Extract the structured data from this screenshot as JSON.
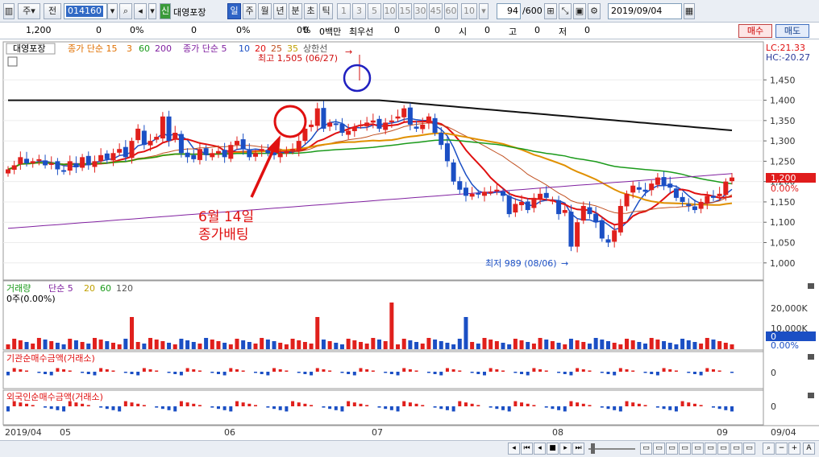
{
  "toolbar": {
    "period": "주",
    "prefix": "전",
    "code": "014160",
    "badge": "신",
    "name": "대영포장",
    "periods": [
      "일",
      "주",
      "월",
      "년",
      "분",
      "초",
      "틱"
    ],
    "nums": [
      "1",
      "3",
      "5",
      "10",
      "15",
      "30",
      "45",
      "60",
      "10"
    ],
    "count": "94",
    "total": "/600",
    "date": "2019/09/04"
  },
  "info": {
    "price": "1,200",
    "change": "0",
    "rate": "0%",
    "v1": "0",
    "pct1": "0%",
    "v2": "0",
    "pct2": "0%",
    "vol": "0백만",
    "hoga": "최우선",
    "h1": "0",
    "h2": "0",
    "s_label": "시",
    "s_val": "0",
    "g_label": "고",
    "g_val": "0",
    "j_label": "저",
    "j_val": "0",
    "buy": "매수",
    "sell": "매도"
  },
  "legend": {
    "name": "대영포장",
    "ma_a": "종가 단순 15",
    "a2": "3",
    "a3": "60",
    "a4": "200",
    "ma_b": "종가 단순 5",
    "b2": "10",
    "b3": "20",
    "b4": "25",
    "b5": "35",
    "b6": "상한선"
  },
  "scale": {
    "lc": "LC:21.33",
    "hc": "HC:-20.27",
    "ticks": [
      "1,450",
      "1,400",
      "1,350",
      "1,300",
      "1,250",
      "1,200",
      "1,150",
      "1,100",
      "1,050",
      "1,000"
    ],
    "price_tag": "1,200",
    "price_pct": "0.00%"
  },
  "annotations": {
    "high": "최고 1,505 (06/27)",
    "low": "최저 989 (08/06)",
    "note1": "6월 14일",
    "note2": "종가배팅"
  },
  "volume": {
    "title": "거래량",
    "ma": "단순 5",
    "m2": "20",
    "m3": "60",
    "m4": "120",
    "current": "0주(0.00%)",
    "ticks": [
      "20,000K",
      "10,000K"
    ],
    "tag": "0",
    "pct": "0.00%"
  },
  "inst": {
    "title": "기관순매수금액(거래소)",
    "zero": "0"
  },
  "foreign": {
    "title": "외국인순매수금액(거래소)",
    "zero": "0"
  },
  "xaxis": {
    "labels": [
      "2019/04",
      "05",
      "06",
      "07",
      "08",
      "09"
    ],
    "right": "09/04"
  },
  "colors": {
    "up": "#e0201c",
    "down": "#1b4fc4"
  },
  "chart_data": {
    "type": "candlestick",
    "period": "daily",
    "y_range": [
      960,
      1500
    ],
    "closes": [
      1230,
      1240,
      1260,
      1245,
      1250,
      1255,
      1240,
      1245,
      1230,
      1225,
      1250,
      1235,
      1260,
      1240,
      1250,
      1265,
      1255,
      1270,
      1280,
      1260,
      1300,
      1330,
      1290,
      1300,
      1310,
      1360,
      1300,
      1320,
      1270,
      1260,
      1255,
      1280,
      1265,
      1270,
      1275,
      1260,
      1290,
      1300,
      1280,
      1260,
      1270,
      1280,
      1270,
      1265,
      1270,
      1275,
      1280,
      1300,
      1330,
      1340,
      1380,
      1330,
      1345,
      1340,
      1320,
      1325,
      1335,
      1340,
      1345,
      1350,
      1330,
      1345,
      1350,
      1360,
      1380,
      1340,
      1330,
      1340,
      1360,
      1320,
      1290,
      1250,
      1200,
      1180,
      1165,
      1170,
      1170,
      1175,
      1175,
      1180,
      1165,
      1120,
      1145,
      1150,
      1130,
      1160,
      1170,
      1160,
      1155,
      1120,
      1130,
      1040,
      1100,
      1140,
      1120,
      1100,
      1060,
      1050,
      1080,
      1140,
      1170,
      1190,
      1180,
      1175,
      1195,
      1210,
      1190,
      1185,
      1160,
      1150,
      1140,
      1130,
      1150,
      1165,
      1160,
      1170,
      1200,
      1210
    ]
  }
}
